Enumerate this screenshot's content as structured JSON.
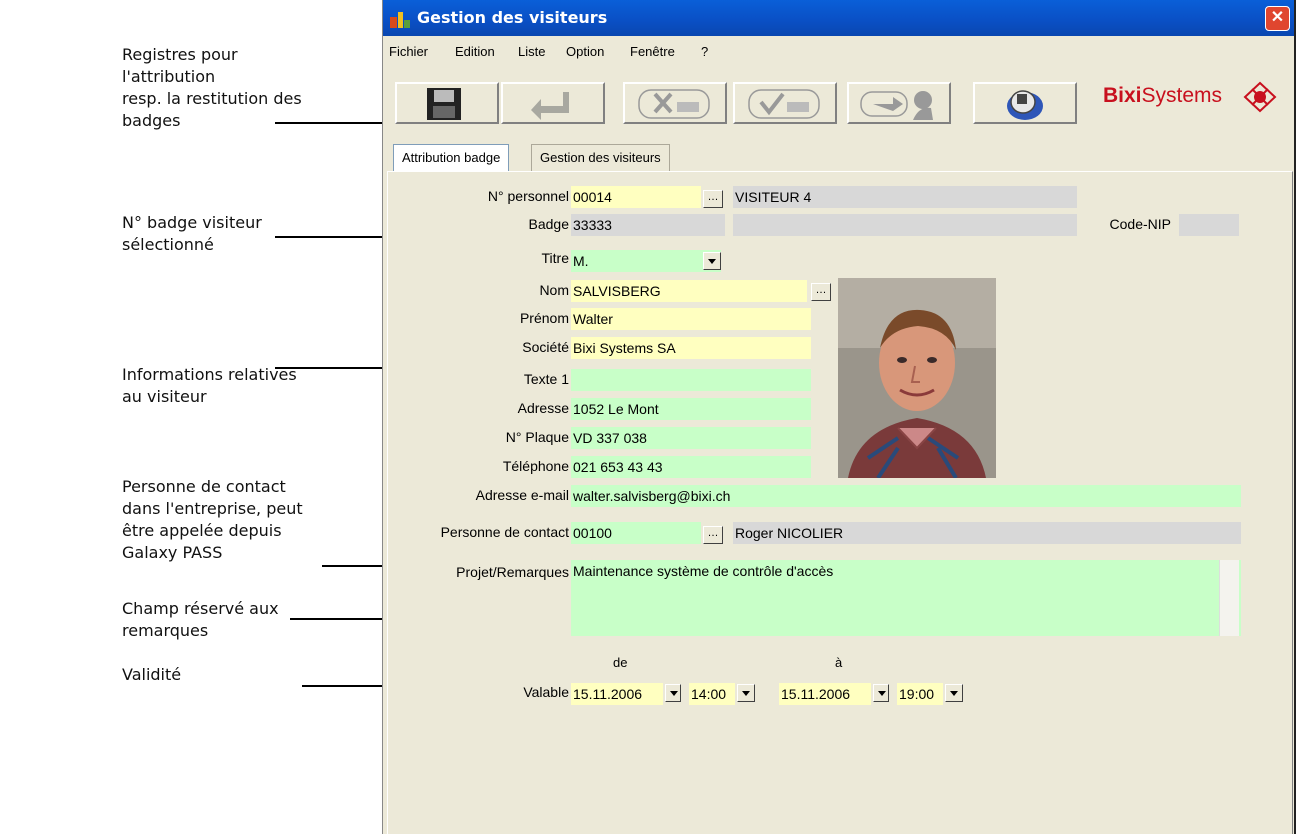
{
  "annotations": {
    "registers": [
      "Registres pour",
      "l'attribution",
      "resp. la restitution des",
      "badges"
    ],
    "badge_selected": [
      "N° badge visiteur",
      "sélectionné"
    ],
    "visitor_info": [
      "Informations relatives",
      "au visiteur"
    ],
    "contact_person": [
      "Personne de contact",
      "dans l'entreprise, peut",
      "être  appelée depuis",
      "Galaxy PASS"
    ],
    "remarks_field": [
      "Champ réservé aux",
      "remarques"
    ],
    "validity": [
      "Validité"
    ]
  },
  "window": {
    "title": "Gestion des visiteurs",
    "close": "✕"
  },
  "menu": [
    "Fichier",
    "Edition",
    "Liste",
    "Option",
    "Fenêtre",
    "?"
  ],
  "toolbar": {
    "brand_bold": "Bixi",
    "brand_rest": "Systems",
    "buttons": [
      "save-icon",
      "return-icon",
      "cancel-badge-icon",
      "validate-badge-icon",
      "exit-visitor-icon",
      "scanner-icon"
    ]
  },
  "tabs": [
    "Attribution badge",
    "Gestion des visiteurs"
  ],
  "form": {
    "personnel_label": "N° personnel",
    "personnel_value": "00014",
    "personnel_name": "VISITEUR 4",
    "badge_label": "Badge",
    "badge_value": "33333",
    "code_nip_label": "Code-NIP",
    "titre_label": "Titre",
    "titre_value": "M.",
    "nom_label": "Nom",
    "nom_value": "SALVISBERG",
    "prenom_label": "Prénom",
    "prenom_value": "Walter",
    "societe_label": "Société",
    "societe_value": "Bixi Systems SA",
    "texte1_label": "Texte 1",
    "texte1_value": "",
    "adresse_label": "Adresse",
    "adresse_value": "1052 Le Mont",
    "plaque_label": "N° Plaque",
    "plaque_value": "VD 337 038",
    "telephone_label": "Téléphone",
    "telephone_value": "021 653 43 43",
    "email_label": "Adresse e-mail",
    "email_value": "walter.salvisberg@bixi.ch",
    "contact_label": "Personne de contact",
    "contact_id": "00100",
    "contact_name": "Roger  NICOLIER",
    "projet_label": "Projet/Remarques",
    "projet_value": "Maintenance système de contrôle d'accès",
    "de_label": "de",
    "a_label": "à",
    "valable_label": "Valable",
    "from_date": "15.11.2006",
    "from_time": "14:00",
    "to_date": "15.11.2006",
    "to_time": "19:00"
  },
  "colors": {
    "title_blue": "#0a4fc4",
    "field_yellow": "#ffffc0",
    "field_green": "#c8ffc8",
    "field_grey": "#d8d8d8",
    "brand_red": "#c8101e"
  }
}
